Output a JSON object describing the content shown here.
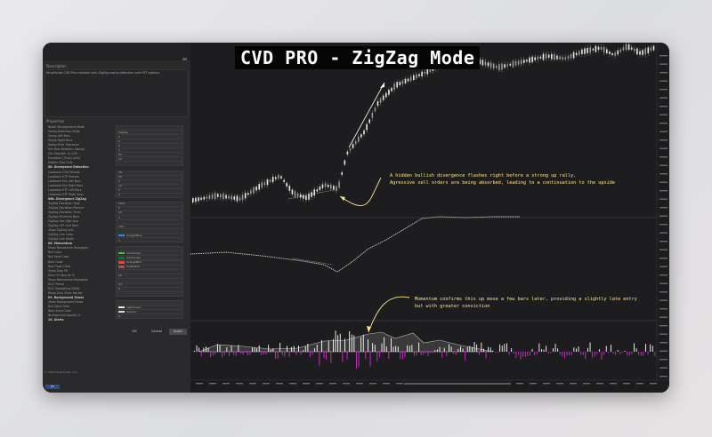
{
  "app": {
    "title": "CVD PRO - ZigZag Mode",
    "footer_left": "© 2025 NinjaTrader, LLC",
    "brand": "NT"
  },
  "panel": {
    "description_heading": "Description",
    "description_text": "NinjaScript CVD Pro indicator with ZigZag swing detection and HTF options",
    "parameters_heading": "Properties",
    "buttons": {
      "ok": "OK",
      "cancel": "Cancel",
      "apply": "Apply"
    },
    "rows": [
      {
        "label": "Break Management Mode",
        "value": "",
        "type": "row"
      },
      {
        "label": "Swing Detection Mode",
        "value": "ZigZag",
        "type": "row"
      },
      {
        "label": "Swing Left Bars",
        "value": "5",
        "type": "row"
      },
      {
        "label": "Swing Right Bars",
        "value": "2",
        "type": "row"
      },
      {
        "label": "Swing Price Tolerance",
        "value": "0",
        "type": "row"
      },
      {
        "label": "Min Bars Between Swings",
        "value": "3",
        "type": "row"
      },
      {
        "label": "Min Strength (0-100)",
        "value": "50",
        "type": "row"
      },
      {
        "label": "Deviation (Ticks) (min)",
        "value": "10",
        "type": "row"
      },
      {
        "label": "Hidden Divs Only",
        "value": "",
        "type": "row"
      },
      {
        "label": "06. Divergence Detection",
        "value": "",
        "type": "group"
      },
      {
        "label": "Lookback CVD Periods",
        "value": "20",
        "type": "row"
      },
      {
        "label": "Lookback HTF Periods",
        "value": "20",
        "type": "row"
      },
      {
        "label": "Lookback Min Left Bars",
        "value": "3",
        "type": "row"
      },
      {
        "label": "Lookback Min Right Bars",
        "value": "10",
        "type": "row"
      },
      {
        "label": "Lookback HTF Left Bars",
        "value": "2",
        "type": "row"
      },
      {
        "label": "Lookback HTF Right Bars",
        "value": "2",
        "type": "row"
      },
      {
        "label": "06b. Divergence ZigZag",
        "value": "",
        "type": "group"
      },
      {
        "label": "ZigZag Deviation Type",
        "value": "Ticks",
        "type": "row"
      },
      {
        "label": "ZigZag Deviation Percent",
        "value": "0",
        "type": "row"
      },
      {
        "label": "ZigZag Deviation Ticks",
        "value": "10",
        "type": "row"
      },
      {
        "label": "ZigZag Minimum Bars",
        "value": "3",
        "type": "row"
      },
      {
        "label": "ZigZag Use High Low",
        "value": "",
        "type": "row"
      },
      {
        "label": "ZigZag HTF Line Bars",
        "value": "100",
        "type": "row"
      },
      {
        "label": "Show ZigZag Line",
        "value": "",
        "type": "row"
      },
      {
        "label": "ZigZag Line Color",
        "value": "DodgerBlue",
        "type": "color",
        "color": "#1e90ff"
      },
      {
        "label": "ZigZag Line Width",
        "value": "1",
        "type": "row"
      },
      {
        "label": "08. Momentum",
        "value": "",
        "type": "group"
      },
      {
        "label": "Show Momentum Histogram",
        "value": "",
        "type": "row"
      },
      {
        "label": "Bull Color",
        "value": "LimeGreen",
        "type": "color",
        "color": "#32cd32"
      },
      {
        "label": "Bull Fade Color",
        "value": "DarkGreen",
        "type": "color",
        "color": "#1d6b2a"
      },
      {
        "label": "Bear Color",
        "value": "OrangeRed",
        "type": "color",
        "color": "#e0453a"
      },
      {
        "label": "Bear Fade Color",
        "value": "IndianRed",
        "type": "color",
        "color": "#b84a4a"
      },
      {
        "label": "Show Zero Fill",
        "value": "",
        "type": "row"
      },
      {
        "label": "Zero Fill Opacity %",
        "value": "20",
        "type": "row"
      },
      {
        "label": "Show Normalized Histogram",
        "value": "",
        "type": "row"
      },
      {
        "label": "ROC Period",
        "value": "14",
        "type": "row"
      },
      {
        "label": "ROC Smoothing (EMA)",
        "value": "3",
        "type": "row"
      },
      {
        "label": "Show Zero Cross Marker",
        "value": "",
        "type": "row"
      },
      {
        "label": "09. Background Zones",
        "value": "",
        "type": "group"
      },
      {
        "label": "Show Background Zones",
        "value": "",
        "type": "row"
      },
      {
        "label": "Bull Zone Color",
        "value": "LightGreen",
        "type": "color",
        "color": "#e8e8e8"
      },
      {
        "label": "Bear Zone Color",
        "value": "Salmon",
        "type": "color",
        "color": "#d7d7d7"
      },
      {
        "label": "Background Opacity %",
        "value": "8",
        "type": "row"
      },
      {
        "label": "10. Alerts",
        "value": "",
        "type": "group"
      }
    ]
  },
  "annotations": {
    "divergence": [
      "A hidden bullish divergence flashes right before a strong up rally.",
      "Agressive sell orders are being absorbed, leading to a continuation to the upside"
    ],
    "momentum": [
      "Momentum confirms this up move a few bars later, providing a slightly late entry",
      "but with greater conviction"
    ]
  },
  "colors": {
    "background": "#1d1d1f",
    "candle_up": "#e8e8e8",
    "candle_down": "#9a9a9a",
    "annotation": "#ffe68a",
    "momentum_bull": "#ffffff",
    "momentum_bear": "#cc33cc"
  }
}
